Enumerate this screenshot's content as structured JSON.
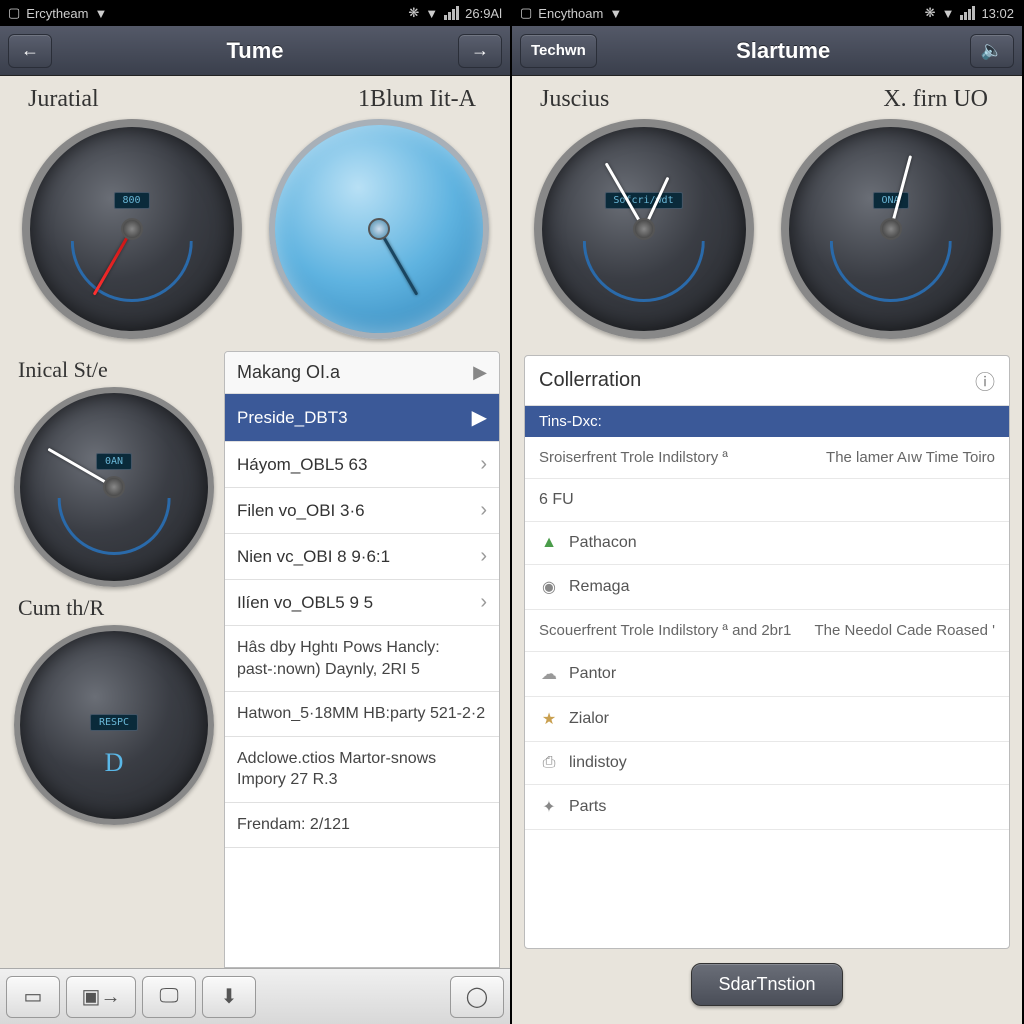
{
  "left": {
    "status": {
      "carrier": "Ercytheam",
      "time": "26:9Al"
    },
    "nav": {
      "title": "Tume"
    },
    "gauges": {
      "top_left": {
        "title": "Juratial",
        "lcd": "800",
        "needle_deg": 210
      },
      "top_right": {
        "title": "1Blum Iit-A",
        "needle_deg": 150
      },
      "mid": {
        "title": "Inical St/e",
        "lcd": "0AN",
        "needle_deg": 300
      },
      "bottom": {
        "title": "Cum th/R",
        "lcd": "RESPC",
        "center_glyph": "D"
      }
    },
    "list": {
      "header": "Makang OI.a",
      "items": [
        {
          "label": "Preside_DBT3",
          "selected": true
        },
        {
          "label": "Háyom_OBL5 63"
        },
        {
          "label": "Filen vo_OBI 3·6"
        },
        {
          "label": "Nien vc_OBI 8 9·6:1"
        },
        {
          "label": "Ilíen vo_OBL5 9 5"
        }
      ],
      "multi": [
        "Hâs dby Hghtı Pows Hancly: past-:nown) Daynly, 2RI 5",
        "Hatwon_5·18MM HB:party 521-2·2",
        "Adclowe.ctios Martor-snows Impory 27 R.3",
        "Frendam: 2/121"
      ]
    }
  },
  "right": {
    "status": {
      "carrier": "Encythoam",
      "time": "13:02"
    },
    "nav": {
      "back": "Techwn",
      "title": "Slartume"
    },
    "gauges": {
      "left": {
        "title": "Juscius",
        "lcd": "Sofcri/wdt"
      },
      "right": {
        "title": "X. firn UO",
        "lcd": "ONA"
      }
    },
    "panel": {
      "header": "Collerration",
      "section": "Tins-Dxc:",
      "row1_left": "Sroiserfrent Trole Indilstory ª",
      "row1_right": "The lamer Aıw Time Toiro",
      "row2": "6 FU",
      "items1": [
        {
          "icon": "▲",
          "label": "Pathacon",
          "color": "#4a9c4a"
        },
        {
          "icon": "◉",
          "label": "Remaga",
          "color": "#888"
        }
      ],
      "row3_left": "Scouerfrent Trole Indilstory ª and 2br1",
      "row3_right": "The Needol Cade Roased '",
      "items2": [
        {
          "icon": "☁",
          "label": "Pantor",
          "color": "#999"
        },
        {
          "icon": "★",
          "label": "Zialor",
          "color": "#c9a050"
        },
        {
          "icon": "⎙",
          "label": "lindistoy",
          "color": "#888"
        },
        {
          "icon": "✦",
          "label": "Parts",
          "color": "#888"
        }
      ]
    },
    "bottom_button": "SdarTnstion"
  }
}
